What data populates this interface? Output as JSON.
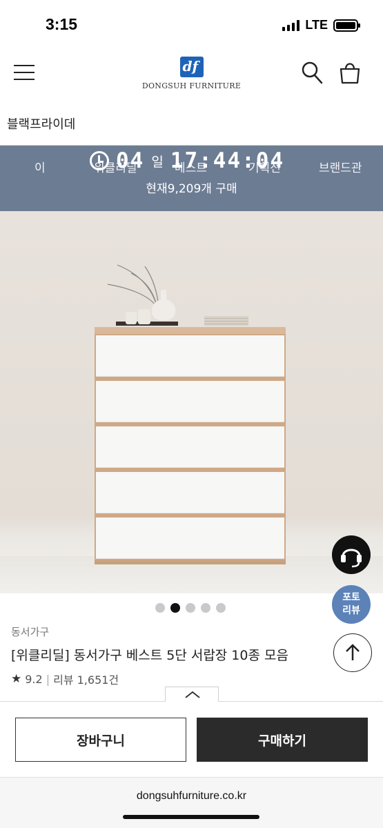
{
  "status_bar": {
    "time": "3:15",
    "network": "LTE"
  },
  "header": {
    "logo_text": "DONGSUH FURNITURE"
  },
  "category_title": "블랙프라이데",
  "banner": {
    "tabs": [
      "이",
      "위클리딜",
      "베스트",
      "기획전",
      "브랜드관"
    ],
    "timer_day": "04",
    "timer_day_unit": "일",
    "timer_time": "17:44:04",
    "purchase_count": "현재9,209개 구매"
  },
  "carousel": {
    "total": 5,
    "active_index": 1
  },
  "floating": {
    "photo_review": "포토\n리뷰"
  },
  "product": {
    "brand": "동서가구",
    "title": "[위클리딜] 동서가구 베스트 5단 서랍장 10종 모음",
    "rating": "9.2",
    "review_label": "리뷰 1,651건"
  },
  "actions": {
    "cart_label": "장바구니",
    "buy_label": "구매하기"
  },
  "browser": {
    "url": "dongsuhfurniture.co.kr"
  },
  "colors": {
    "banner_bg": "#6c7c93",
    "buy_bg": "#2b2b2b",
    "photo_review_bg": "#5c82b8"
  }
}
